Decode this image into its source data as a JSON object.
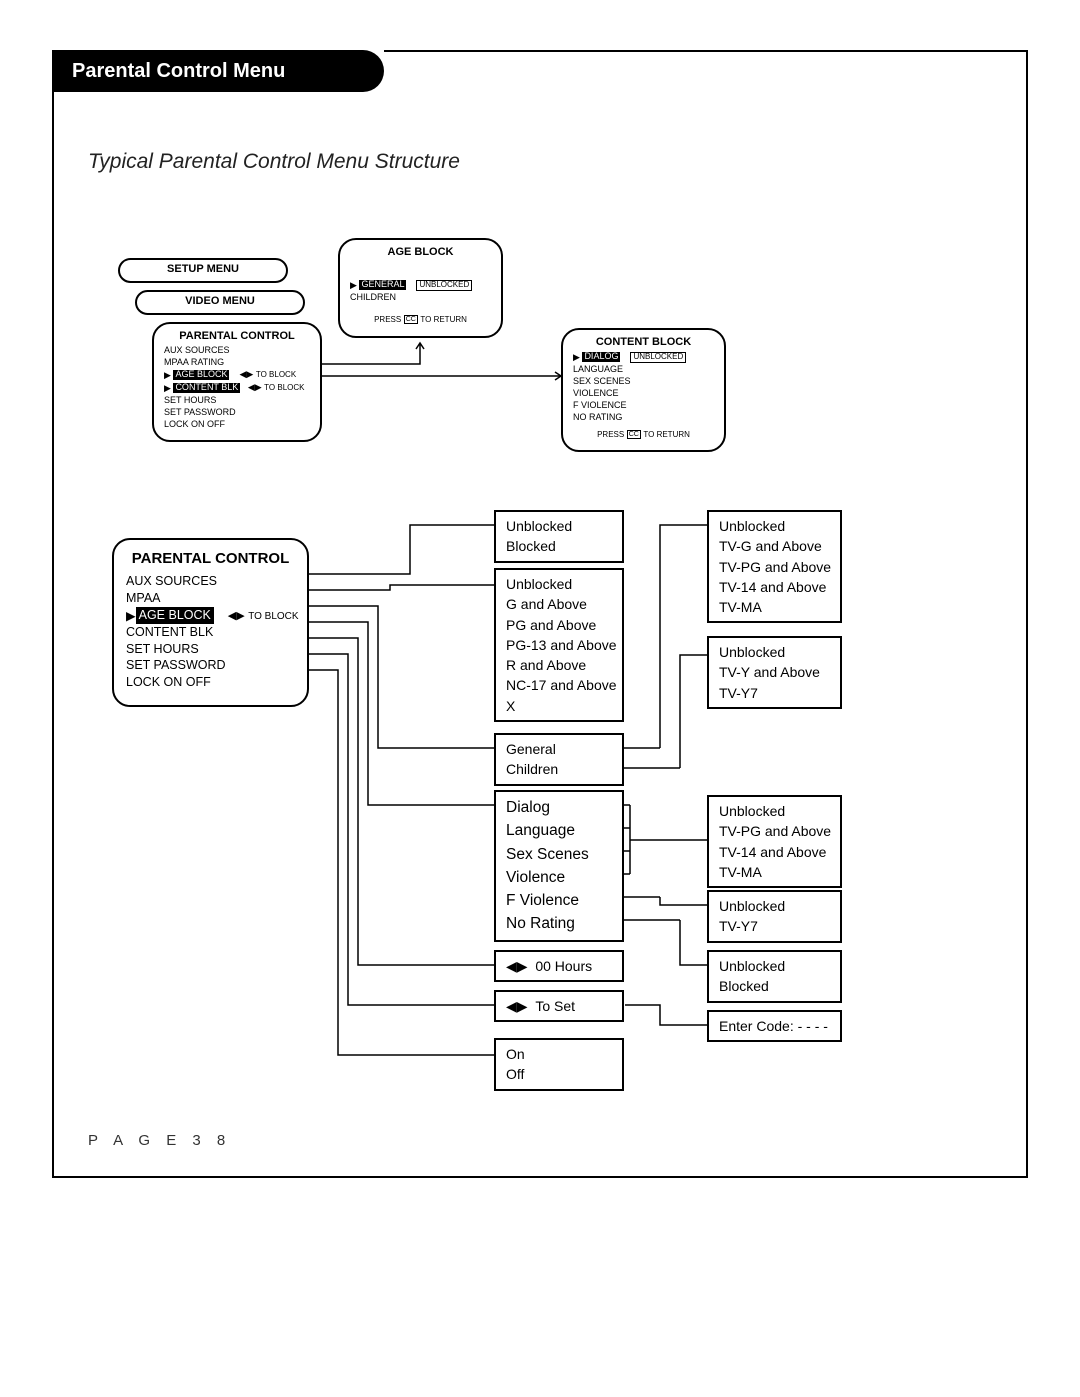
{
  "header": {
    "tab": "Parental Control Menu"
  },
  "subtitle": "Typical Parental Control Menu Structure",
  "page_label": "P A G E  3 8",
  "setup_menu": {
    "title": "SETUP MENU"
  },
  "video_menu": {
    "title": "VIDEO MENU"
  },
  "parental_small": {
    "title": "PARENTAL CONTROL",
    "rows": {
      "aux": "AUX SOURCES",
      "mpaa": "MPAA RATING",
      "age": "AGE BLOCK",
      "age_hint": "TO BLOCK",
      "content": "CONTENT BLK",
      "content_hint": "TO BLOCK",
      "sethours": "SET HOURS",
      "setpwd": "SET PASSWORD",
      "lock": "LOCK ON OFF"
    }
  },
  "age_block_box": {
    "title": "AGE BLOCK",
    "general": "GENERAL",
    "general_state": "UNBLOCKED",
    "children": "CHILDREN",
    "return_pre": "PRESS",
    "return_cc": "CC",
    "return_post": "TO RETURN"
  },
  "content_block_box": {
    "title": "CONTENT BLOCK",
    "dialog": "DIALOG",
    "dialog_state": "UNBLOCKED",
    "rows": {
      "language": "LANGUAGE",
      "sex": "SEX SCENES",
      "violence": "VIOLENCE",
      "fviolence": "F VIOLENCE",
      "norating": "NO RATING"
    },
    "return_pre": "PRESS",
    "return_cc": "CC",
    "return_post": "TO RETURN"
  },
  "parental_big": {
    "title": "PARENTAL CONTROL",
    "rows": {
      "aux": "AUX SOURCES",
      "mpaa": "MPAA",
      "age": "AGE BLOCK",
      "age_hint": "TO BLOCK",
      "content": "CONTENT BLK",
      "sethours": "SET HOURS",
      "setpwd": "SET PASSWORD",
      "lock": "LOCK ON OFF"
    }
  },
  "opt_aux": {
    "l1": "Unblocked",
    "l2": "Blocked"
  },
  "opt_mpaa": {
    "l1": "Unblocked",
    "l2": "G and Above",
    "l3": "PG and Above",
    "l4": "PG-13 and Above",
    "l5": "R and Above",
    "l6": "NC-17 and Above",
    "l7": "X"
  },
  "opt_age": {
    "l1": "General",
    "l2": "Children"
  },
  "opt_content": {
    "l1": "Dialog",
    "l2": "Language",
    "l3": "Sex Scenes",
    "l4": "Violence",
    "l5": "F Violence",
    "l6": "No Rating"
  },
  "opt_hours": {
    "arrows": "◀▶",
    "label": "00 Hours"
  },
  "opt_toset": {
    "arrows": "◀▶",
    "label": "To Set"
  },
  "opt_onoff": {
    "l1": "On",
    "l2": "Off"
  },
  "opt_general": {
    "l1": "Unblocked",
    "l2": "TV-G and Above",
    "l3": "TV-PG and Above",
    "l4": "TV-14 and Above",
    "l5": "TV-MA"
  },
  "opt_children": {
    "l1": "Unblocked",
    "l2": "TV-Y and Above",
    "l3": "TV-Y7"
  },
  "opt_content_sub1": {
    "l1": "Unblocked",
    "l2": "TV-PG and Above",
    "l3": "TV-14 and Above",
    "l4": "TV-MA"
  },
  "opt_fviolence": {
    "l1": "Unblocked",
    "l2": "TV-Y7"
  },
  "opt_norating": {
    "l1": "Unblocked",
    "l2": "Blocked"
  },
  "opt_enter_code": {
    "label": "Enter Code: - - - -"
  },
  "glyphs": {
    "tri_right": "▶",
    "lr_arrows": "◀▶"
  }
}
